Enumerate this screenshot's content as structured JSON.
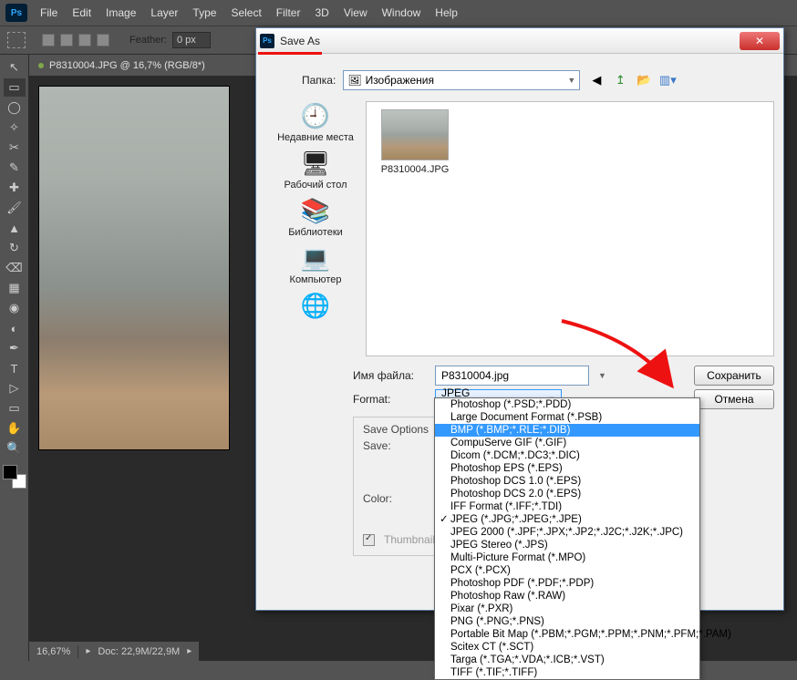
{
  "menu": [
    "File",
    "Edit",
    "Image",
    "Layer",
    "Type",
    "Select",
    "Filter",
    "3D",
    "View",
    "Window",
    "Help"
  ],
  "options_bar": {
    "feather_label": "Feather:",
    "feather_value": "0 px"
  },
  "doc": {
    "tab": "P8310004.JPG @ 16,7% (RGB/8*)",
    "zoom": "16,67%",
    "docsize": "Doc: 22,9M/22,9M"
  },
  "dialog": {
    "title": "Save As",
    "folder_label": "Папка:",
    "folder_value": "Изображения",
    "places": [
      "Недавние места",
      "Рабочий стол",
      "Библиотеки",
      "Компьютер"
    ],
    "file_item": "P8310004.JPG",
    "filename_label": "Имя файла:",
    "filename_value": "P8310004.jpg",
    "format_label": "Format:",
    "format_value": "JPEG (*.JPG;*.JPEG;*.JPE)",
    "save_btn": "Сохранить",
    "cancel_btn": "Отмена",
    "save_options_title": "Save Options",
    "save_label": "Save:",
    "color_label": "Color:",
    "thumbnail_label": "Thumbnail"
  },
  "format_options": [
    "Photoshop (*.PSD;*.PDD)",
    "Large Document Format (*.PSB)",
    "BMP (*.BMP;*.RLE;*.DIB)",
    "CompuServe GIF (*.GIF)",
    "Dicom (*.DCM;*.DC3;*.DIC)",
    "Photoshop EPS (*.EPS)",
    "Photoshop DCS 1.0 (*.EPS)",
    "Photoshop DCS 2.0 (*.EPS)",
    "IFF Format (*.IFF;*.TDI)",
    "JPEG (*.JPG;*.JPEG;*.JPE)",
    "JPEG 2000 (*.JPF;*.JPX;*.JP2;*.J2C;*.J2K;*.JPC)",
    "JPEG Stereo (*.JPS)",
    "Multi-Picture Format (*.MPO)",
    "PCX (*.PCX)",
    "Photoshop PDF (*.PDF;*.PDP)",
    "Photoshop Raw (*.RAW)",
    "Pixar (*.PXR)",
    "PNG (*.PNG;*.PNS)",
    "Portable Bit Map (*.PBM;*.PGM;*.PPM;*.PNM;*.PFM;*.PAM)",
    "Scitex CT (*.SCT)",
    "Targa (*.TGA;*.VDA;*.ICB;*.VST)",
    "TIFF (*.TIF;*.TIFF)"
  ],
  "format_hl_index": 2,
  "format_checked_index": 9
}
